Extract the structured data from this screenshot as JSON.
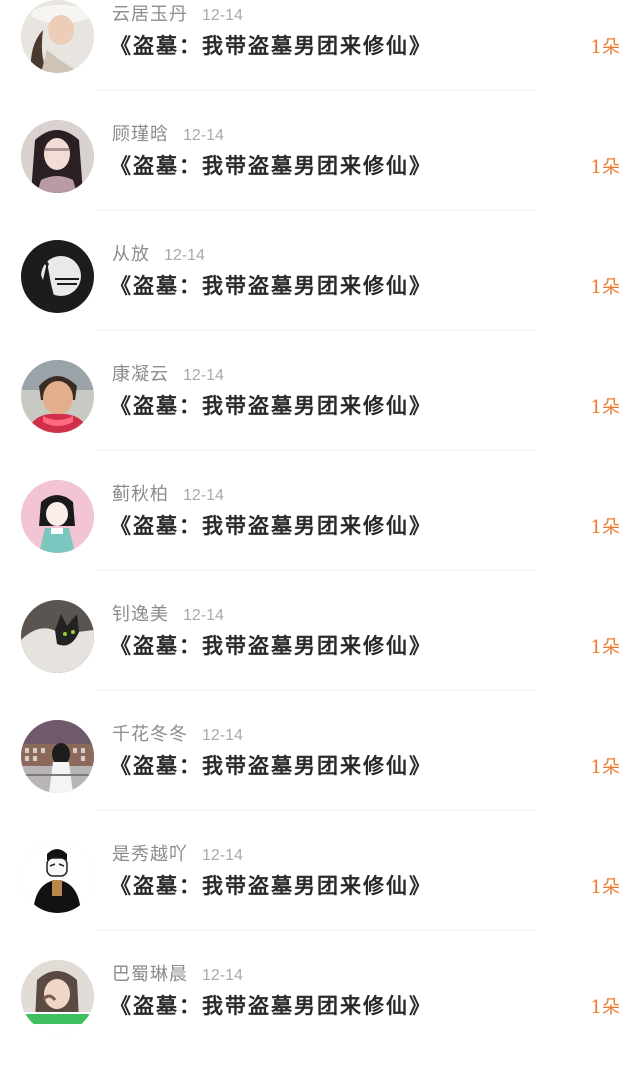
{
  "book_title": "《盗墓：我带盗墓男团来修仙》",
  "accent_color": "#f07b2c",
  "items": [
    {
      "name": "云居玉丹",
      "date": "12-14",
      "title": "《盗墓：我带盗墓男团来修仙》",
      "gift": "1朵",
      "avatar": "woman-with-hat-avatar"
    },
    {
      "name": "顾瑾晗",
      "date": "12-14",
      "title": "《盗墓：我带盗墓男团来修仙》",
      "gift": "1朵",
      "avatar": "dark-haired-girl-avatar"
    },
    {
      "name": "从放",
      "date": "12-14",
      "title": "《盗墓：我带盗墓男团来修仙》",
      "gift": "1朵",
      "avatar": "halloween-logo-avatar"
    },
    {
      "name": "康凝云",
      "date": "12-14",
      "title": "《盗墓：我带盗墓男团来修仙》",
      "gift": "1朵",
      "avatar": "woman-red-scarf-avatar"
    },
    {
      "name": "蓟秋柏",
      "date": "12-14",
      "title": "《盗墓：我带盗墓男团来修仙》",
      "gift": "1朵",
      "avatar": "illustrated-girl-avatar"
    },
    {
      "name": "钊逸美",
      "date": "12-14",
      "title": "《盗墓：我带盗墓男团来修仙》",
      "gift": "1朵",
      "avatar": "cat-avatar"
    },
    {
      "name": "千花冬冬",
      "date": "12-14",
      "title": "《盗墓：我带盗墓男团来修仙》",
      "gift": "1朵",
      "avatar": "building-silhouette-avatar"
    },
    {
      "name": "是秀越吖",
      "date": "12-14",
      "title": "《盗墓：我带盗墓男团来修仙》",
      "gift": "1朵",
      "avatar": "masked-man-avatar"
    },
    {
      "name": "巴蜀琳晨",
      "date": "12-14",
      "title": "《盗墓：我带盗墓男团来修仙》",
      "gift": "1朵",
      "avatar": "girl-banner-avatar"
    }
  ]
}
